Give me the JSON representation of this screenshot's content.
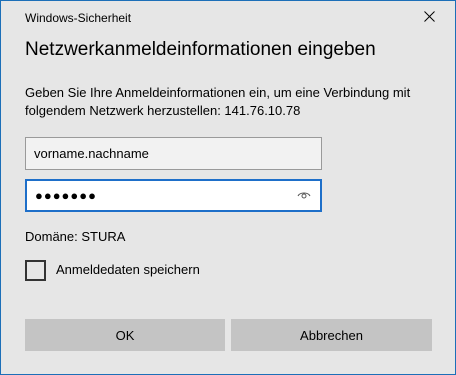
{
  "window": {
    "title": "Windows-Sicherheit",
    "close_icon": "close-icon"
  },
  "dialog": {
    "heading": "Netzwerkanmeldeinformationen eingeben",
    "description": "Geben Sie Ihre Anmeldeinformationen ein, um eine Verbindung mit folgendem Netzwerk herzustellen: 141.76.10.78"
  },
  "form": {
    "username_value": "vorname.nachname",
    "password_masked": "●●●●●●●",
    "reveal_icon": "eye-icon",
    "domain_text": "Domäne: STURA",
    "remember_label": "Anmeldedaten speichern",
    "remember_checked": false
  },
  "buttons": {
    "ok_label": "OK",
    "cancel_label": "Abbrechen"
  },
  "colors": {
    "accent": "#1e6fc9",
    "dialog_bg": "#e6e6e6",
    "button_bg": "#c4c4c4"
  }
}
